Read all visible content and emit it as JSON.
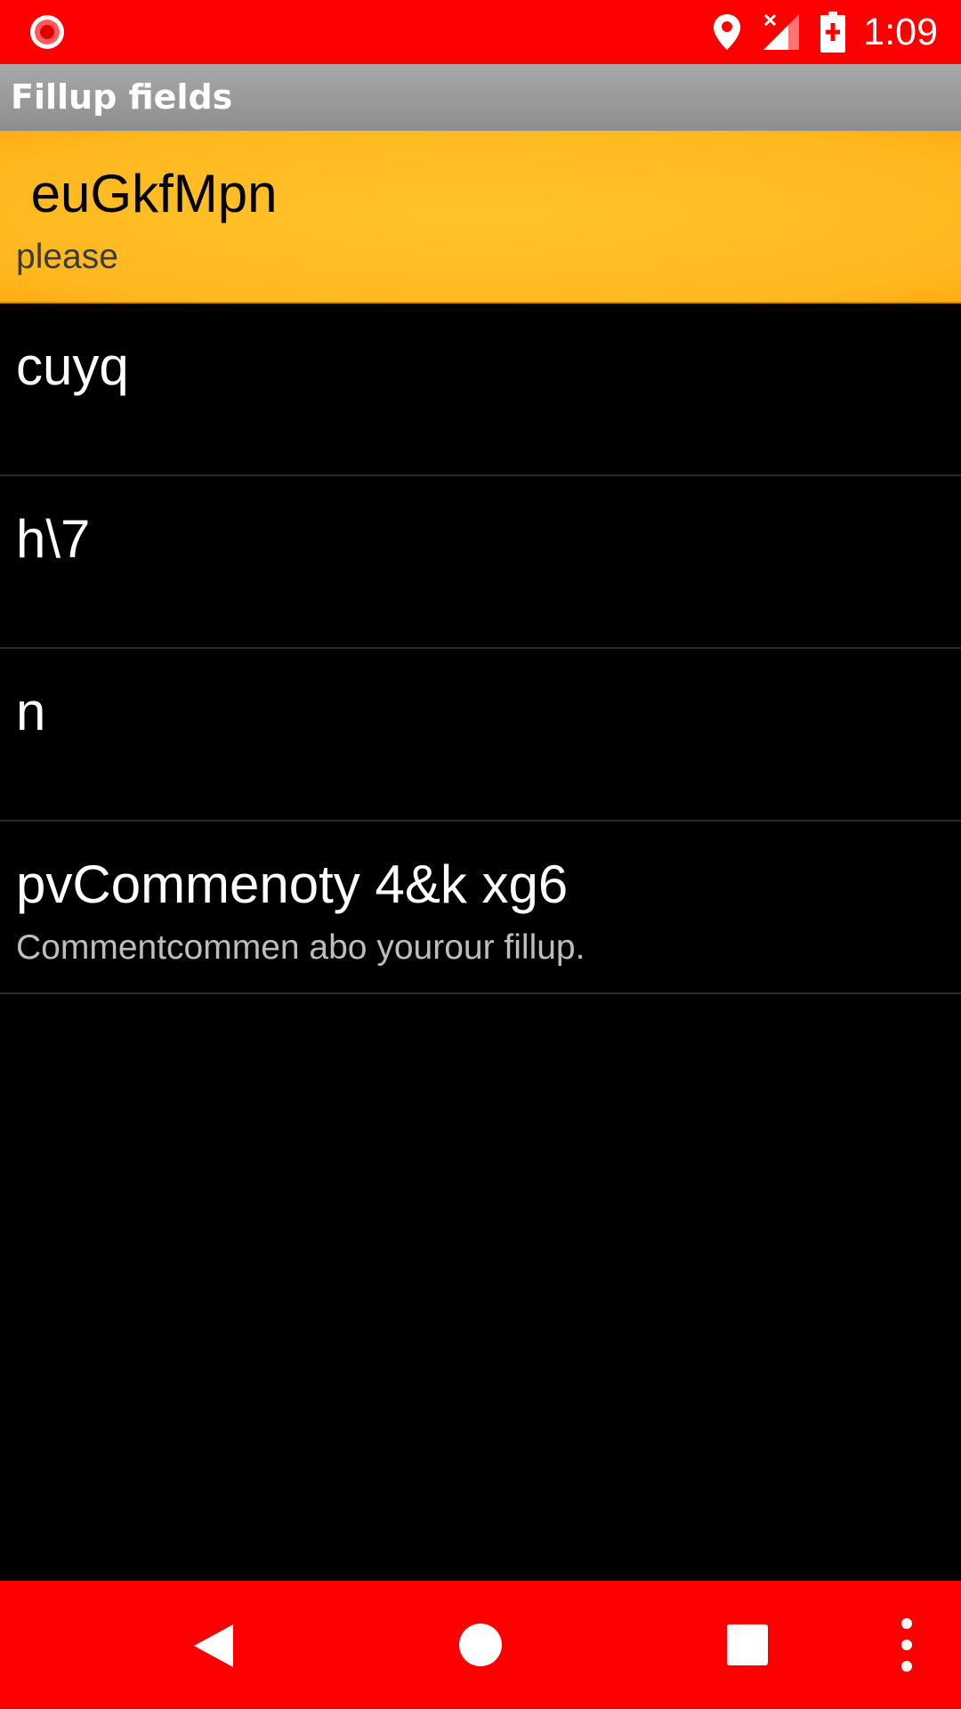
{
  "status_bar": {
    "time": "1:09",
    "icons": [
      "record-icon",
      "location-icon",
      "signal-no-data-icon",
      "battery-charging-icon"
    ]
  },
  "header": {
    "title": "Fillup fields"
  },
  "list": {
    "items": [
      {
        "title": " euGkfMpn",
        "subtitle": "please",
        "selected": true
      },
      {
        "title": "cuyq",
        "subtitle": "",
        "selected": false
      },
      {
        "title": "h\\7",
        "subtitle": "",
        "selected": false
      },
      {
        "title": "n",
        "subtitle": "",
        "selected": false
      },
      {
        "title": "pvCommenoty 4&k xg6",
        "subtitle": "Commentcommen abo yourour fillup.",
        "selected": false
      }
    ]
  },
  "nav_bar": {
    "icons": [
      "back-icon",
      "home-icon",
      "recents-icon",
      "overflow-menu-icon"
    ]
  },
  "colors": {
    "status_bar": "#ff0000",
    "nav_bar": "#ff0000",
    "title_bar": "#9a9a9a",
    "selected_row": "#ffb81f",
    "background": "#000000"
  }
}
